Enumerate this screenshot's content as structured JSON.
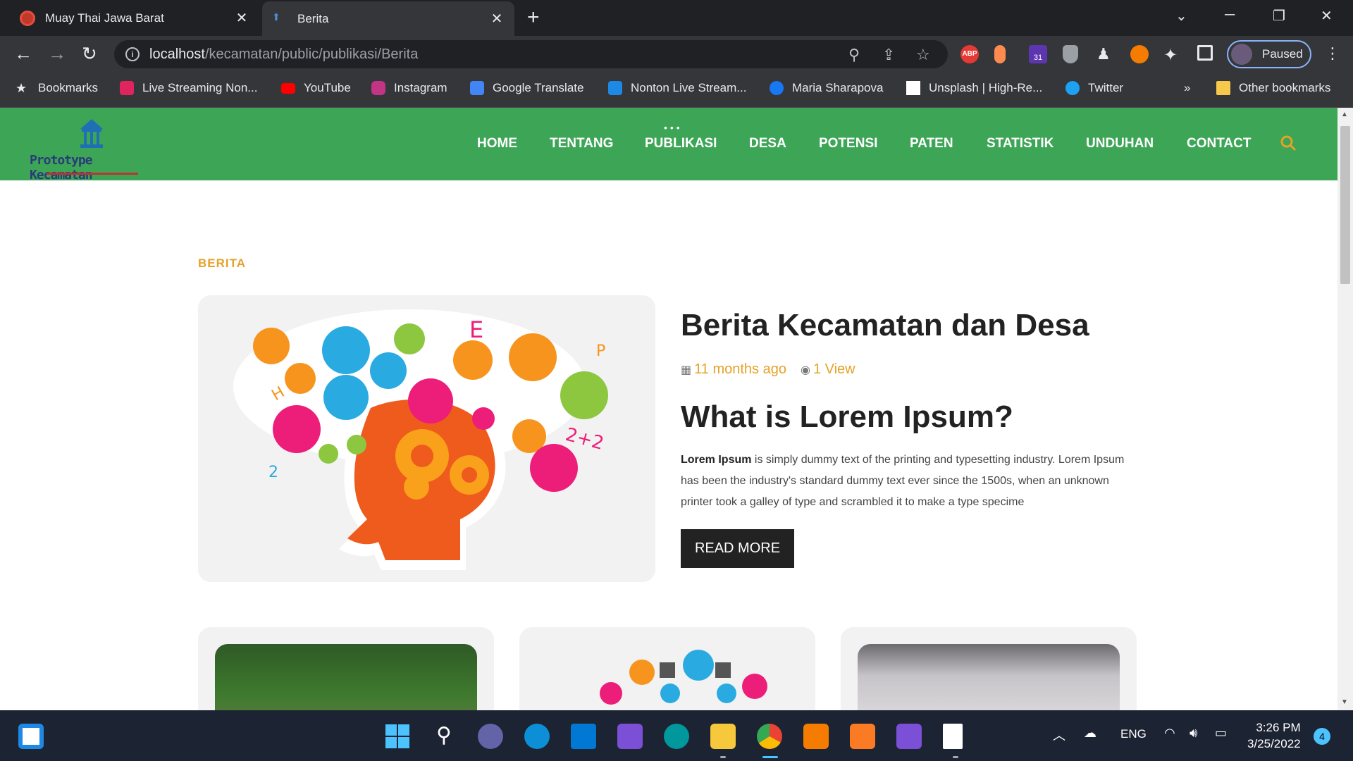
{
  "browser": {
    "tabs": [
      {
        "title": "Muay Thai Jawa Barat",
        "active": false,
        "favicon_color": "#c0392b"
      },
      {
        "title": "Berita",
        "active": true,
        "favicon_color": "#4a90d9"
      }
    ],
    "url": {
      "host": "localhost",
      "path": "/kecamatan/public/publikasi/Berita"
    },
    "profile_label": "Paused",
    "extension_badge": "31",
    "abp_label": "ABP",
    "bookmarks": [
      {
        "label": "Bookmarks",
        "icon": "star-icon",
        "color": "#e8eaed"
      },
      {
        "label": "Live Streaming Non...",
        "icon": "vidio-icon",
        "color": "#e0245e"
      },
      {
        "label": "YouTube",
        "icon": "youtube-icon",
        "color": "#ff0000"
      },
      {
        "label": "Instagram",
        "icon": "instagram-icon",
        "color": "#c13584"
      },
      {
        "label": "Google Translate",
        "icon": "translate-icon",
        "color": "#4285f4"
      },
      {
        "label": "Nonton Live Stream...",
        "icon": "stream-icon",
        "color": "#1e88e5"
      },
      {
        "label": "Maria Sharapova",
        "icon": "facebook-icon",
        "color": "#1877f2"
      },
      {
        "label": "Unsplash | High-Re...",
        "icon": "unsplash-icon",
        "color": "#ffffff"
      },
      {
        "label": "Twitter",
        "icon": "twitter-icon",
        "color": "#1da1f2"
      }
    ],
    "overflow_label": "»",
    "other_bookmarks": "Other bookmarks"
  },
  "site": {
    "logo_text": "Prototype Kecamatan",
    "menu": [
      "HOME",
      "TENTANG",
      "PUBLIKASI",
      "DESA",
      "POTENSI",
      "PATEN",
      "STATISTIK",
      "UNDUHAN",
      "CONTACT"
    ],
    "accent": "#e5a228",
    "nav_color": "#3ca556"
  },
  "content": {
    "section_label": "BERITA",
    "news_title": "Berita Kecamatan dan Desa",
    "time_ago": "11 months ago",
    "views": "1 View",
    "subtitle": "What is Lorem Ipsum?",
    "excerpt_bold": "Lorem Ipsum",
    "excerpt_rest": " is simply dummy text of the printing and typesetting industry. Lorem Ipsum has been the industry's standard dummy text ever since the 1500s, when an unknown printer took a galley of type and scrambled it to make a type specime",
    "read_more": "READ MORE"
  },
  "taskbar": {
    "lang": "ENG",
    "time": "3:26 PM",
    "date": "3/25/2022",
    "notifications": "4"
  }
}
